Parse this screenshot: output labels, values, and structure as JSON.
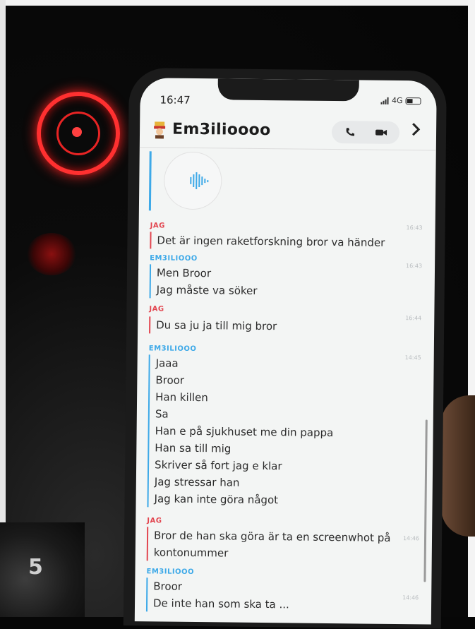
{
  "status_bar": {
    "time": "16:47",
    "network": "4G"
  },
  "header": {
    "chat_name": "Em3ilioooo"
  },
  "chat": {
    "messages": [
      {
        "sender": "JAG",
        "side": "me",
        "time": "16:43",
        "lines": [
          "Det är ingen raketforskning bror va händer"
        ]
      },
      {
        "sender": "EM3ILIOOO",
        "side": "them",
        "time": "16:43",
        "lines": [
          "Men Broor",
          "Jag måste va söker"
        ]
      },
      {
        "sender": "JAG",
        "side": "me",
        "time": "16:44",
        "lines": [
          "Du sa ju ja till mig bror"
        ]
      },
      {
        "sender": "EM3ILIOOO",
        "side": "them",
        "time": "14:45",
        "lines": [
          "Jaaa",
          "Broor",
          "Han killen",
          "Sa",
          "Han e på sjukhuset me din pappa",
          "Han sa till mig",
          "Skriver så fort jag e klar",
          "Jag stressar han",
          "Jag kan inte göra något"
        ]
      },
      {
        "sender": "JAG",
        "side": "me",
        "time": "14:46",
        "lines": [
          "Bror de han ska göra är ta en screenwhot på",
          "kontonummer"
        ]
      },
      {
        "sender": "EM3ILIOOO",
        "side": "them",
        "time": "14:46",
        "lines": [
          "Broor",
          "De inte han som ska ta ... "
        ]
      }
    ]
  },
  "dashboard": {
    "knob_number": "5"
  },
  "colors": {
    "me": "#e2454f",
    "them": "#3da9e8",
    "screen_bg": "#f3f5f4"
  },
  "icons": [
    "avatar-icon",
    "phone-icon",
    "video-icon",
    "chevron-right-icon",
    "voice-note-icon"
  ]
}
